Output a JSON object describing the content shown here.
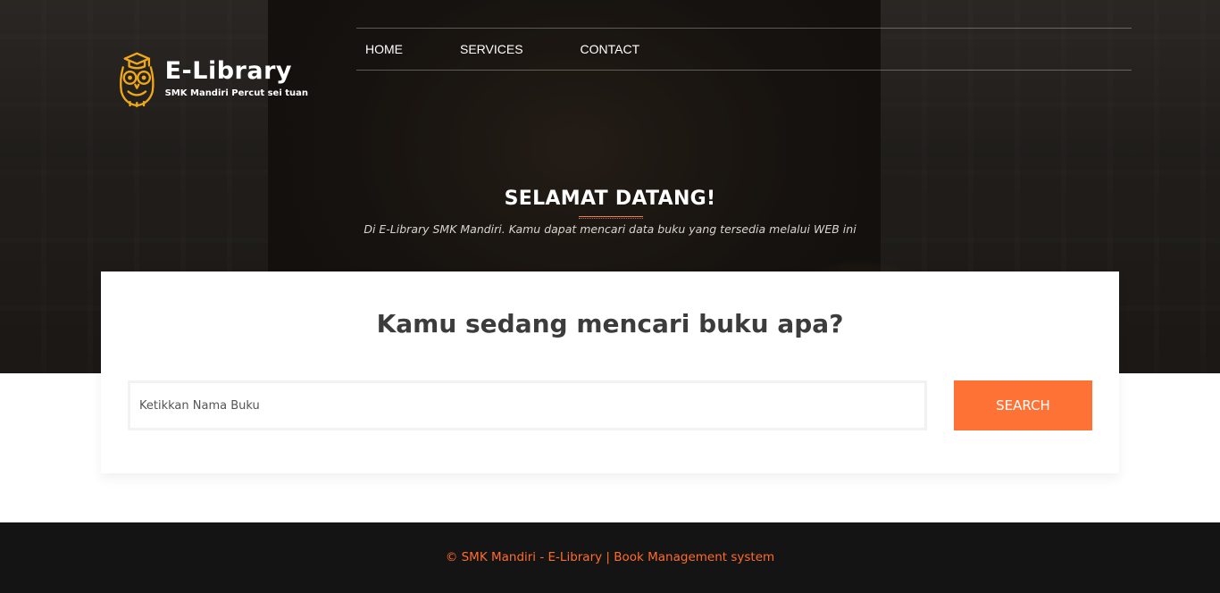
{
  "brand": {
    "title": "E-Library",
    "subtitle": "SMK Mandiri Percut sei tuan",
    "logo_icon": "owl-icon",
    "logo_color": "#f0a818"
  },
  "nav": {
    "items": [
      {
        "label": "HOME"
      },
      {
        "label": "SERVICES"
      },
      {
        "label": "CONTACT"
      }
    ]
  },
  "hero": {
    "title": "SELAMAT DATANG!",
    "subtitle": "Di E-Library SMK Mandiri. Kamu dapat mencari data buku yang tersedia melalui WEB ini"
  },
  "search": {
    "heading": "Kamu sedang mencari buku apa?",
    "placeholder": "Ketikkan Nama Buku",
    "value": "",
    "button_label": "SEARCH",
    "button_color": "#ff7235"
  },
  "footer": {
    "text": "© SMK Mandiri - E-Library | Book Management system",
    "text_color": "#ff6b2c"
  }
}
